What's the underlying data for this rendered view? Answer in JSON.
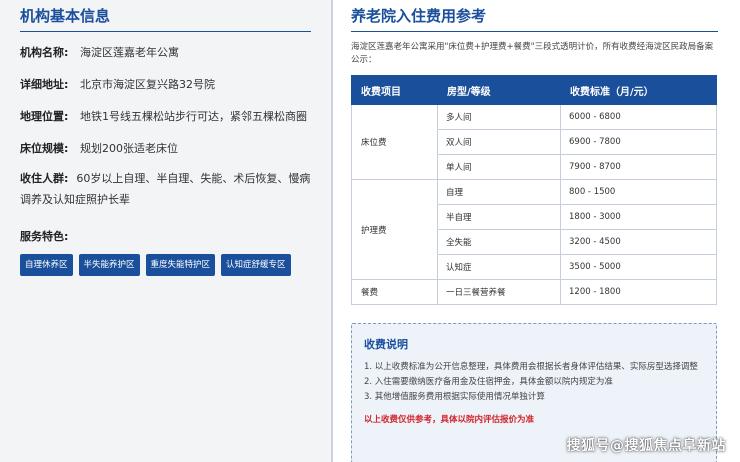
{
  "left": {
    "title": "机构基本信息",
    "rows": [
      {
        "label": "机构名称:",
        "value": "海淀区莲嘉老年公寓"
      },
      {
        "label": "详细地址:",
        "value": "北京市海淀区复兴路32号院"
      },
      {
        "label": "地理位置:",
        "value": "地铁1号线五棵松站步行可达，紧邻五棵松商圈"
      },
      {
        "label": "床位规模:",
        "value": "规划200张适老床位"
      }
    ],
    "group": {
      "label": "收住人群:",
      "value": "60岁以上自理、半自理、失能、术后恢复、慢病调养及认知症照护长辈"
    },
    "features_title": "服务特色:",
    "tags": [
      "自理休养区",
      "半失能养护区",
      "重度失能特护区",
      "认知症舒缓专区"
    ]
  },
  "right": {
    "title": "养老院入住费用参考",
    "intro": "海淀区莲嘉老年公寓采用\"床位费+护理费+餐费\"三段式透明计价，所有收费经海淀区民政局备案公示：",
    "table": {
      "headers": [
        "收费项目",
        "房型/等级",
        "收费标准（月/元）"
      ],
      "groups": [
        {
          "category": "床位费",
          "rows": [
            {
              "type": "多人间",
              "price": "6000 - 6800"
            },
            {
              "type": "双人间",
              "price": "6900 - 7800"
            },
            {
              "type": "单人间",
              "price": "7900 - 8700"
            }
          ]
        },
        {
          "category": "护理费",
          "rows": [
            {
              "type": "自理",
              "price": "800 - 1500"
            },
            {
              "type": "半自理",
              "price": "1800 - 3000"
            },
            {
              "type": "全失能",
              "price": "3200 - 4500"
            },
            {
              "type": "认知症",
              "price": "3500 - 5000"
            }
          ]
        },
        {
          "category": "餐费",
          "rows": [
            {
              "type": "一日三餐营养餐",
              "price": "1200 - 1800"
            }
          ]
        }
      ]
    },
    "notes": {
      "title": "收费说明",
      "items": [
        "1. 以上收费标准为公开信息整理，具体费用会根据长者身体评估结果、实际房型选择调整",
        "2. 入住需要缴纳医疗备用金及住宿押金，具体金额以院内规定为准",
        "3. 其他增值服务费用根据实际使用情况单独计算"
      ],
      "warning": "以上收费仅供参考，具体以院内评估报价为准"
    }
  },
  "watermark": "搜狐号@搜狐焦点阜新站",
  "colors": {
    "primary": "#1a4f9c",
    "warning": "#d0242b",
    "left_bg": "#f3f4f6"
  }
}
